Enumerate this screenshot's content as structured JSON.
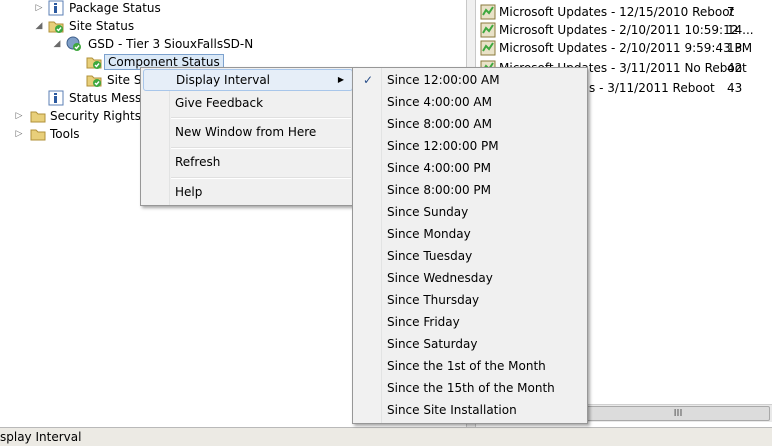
{
  "tree": {
    "items": [
      {
        "label": "Package Status",
        "icon": "info-icon"
      },
      {
        "label": "Site Status",
        "icon": "folder-check-icon"
      },
      {
        "label": "GSD - Tier 3 SiouxFallsSD-N",
        "icon": "server-check-icon"
      },
      {
        "label": "Component Status",
        "icon": "folder-check-icon"
      },
      {
        "label": "Site Sy",
        "icon": "folder-check-icon"
      },
      {
        "label": "Status Messag",
        "icon": "info-icon"
      },
      {
        "label": "Security Rights",
        "icon": "folder-icon"
      },
      {
        "label": "Tools",
        "icon": "folder-icon"
      }
    ]
  },
  "list": {
    "rows": [
      {
        "text": "Microsoft Updates - 12/15/2010 Reboot",
        "count": "7"
      },
      {
        "text": "Microsoft Updates - 2/10/2011 10:59:12 ...",
        "count": "14"
      },
      {
        "text": "Microsoft Updates - 2/10/2011 9:59:43 PM",
        "count": "13"
      },
      {
        "text": "Microsoft Updates - 3/11/2011 No Reboot",
        "count": "42"
      },
      {
        "text": "s - 3/11/2011 Reboot",
        "count": "43"
      }
    ]
  },
  "context_menu": {
    "items": [
      {
        "label": "Display Interval",
        "has_submenu": true
      },
      {
        "label": "Give Feedback"
      },
      {
        "label": "New Window from Here"
      },
      {
        "label": "Refresh"
      },
      {
        "label": "Help"
      }
    ]
  },
  "submenu": {
    "check_mark": "✓",
    "items": [
      "Since 12:00:00 AM",
      "Since 4:00:00 AM",
      "Since 8:00:00 AM",
      "Since 12:00:00 PM",
      "Since 4:00:00 PM",
      "Since 8:00:00 PM",
      "Since Sunday",
      "Since Monday",
      "Since Tuesday",
      "Since Wednesday",
      "Since Thursday",
      "Since Friday",
      "Since Saturday",
      "Since the 1st of the Month",
      "Since the 15th of the Month",
      "Since Site Installation"
    ]
  },
  "scrollbar": {
    "grip": "III"
  },
  "status_bar": {
    "text": "splay Interval"
  },
  "colors": {
    "selection": "#dbe9f7",
    "hot_item": "#e6eef8",
    "check": "#2a4f8a"
  }
}
